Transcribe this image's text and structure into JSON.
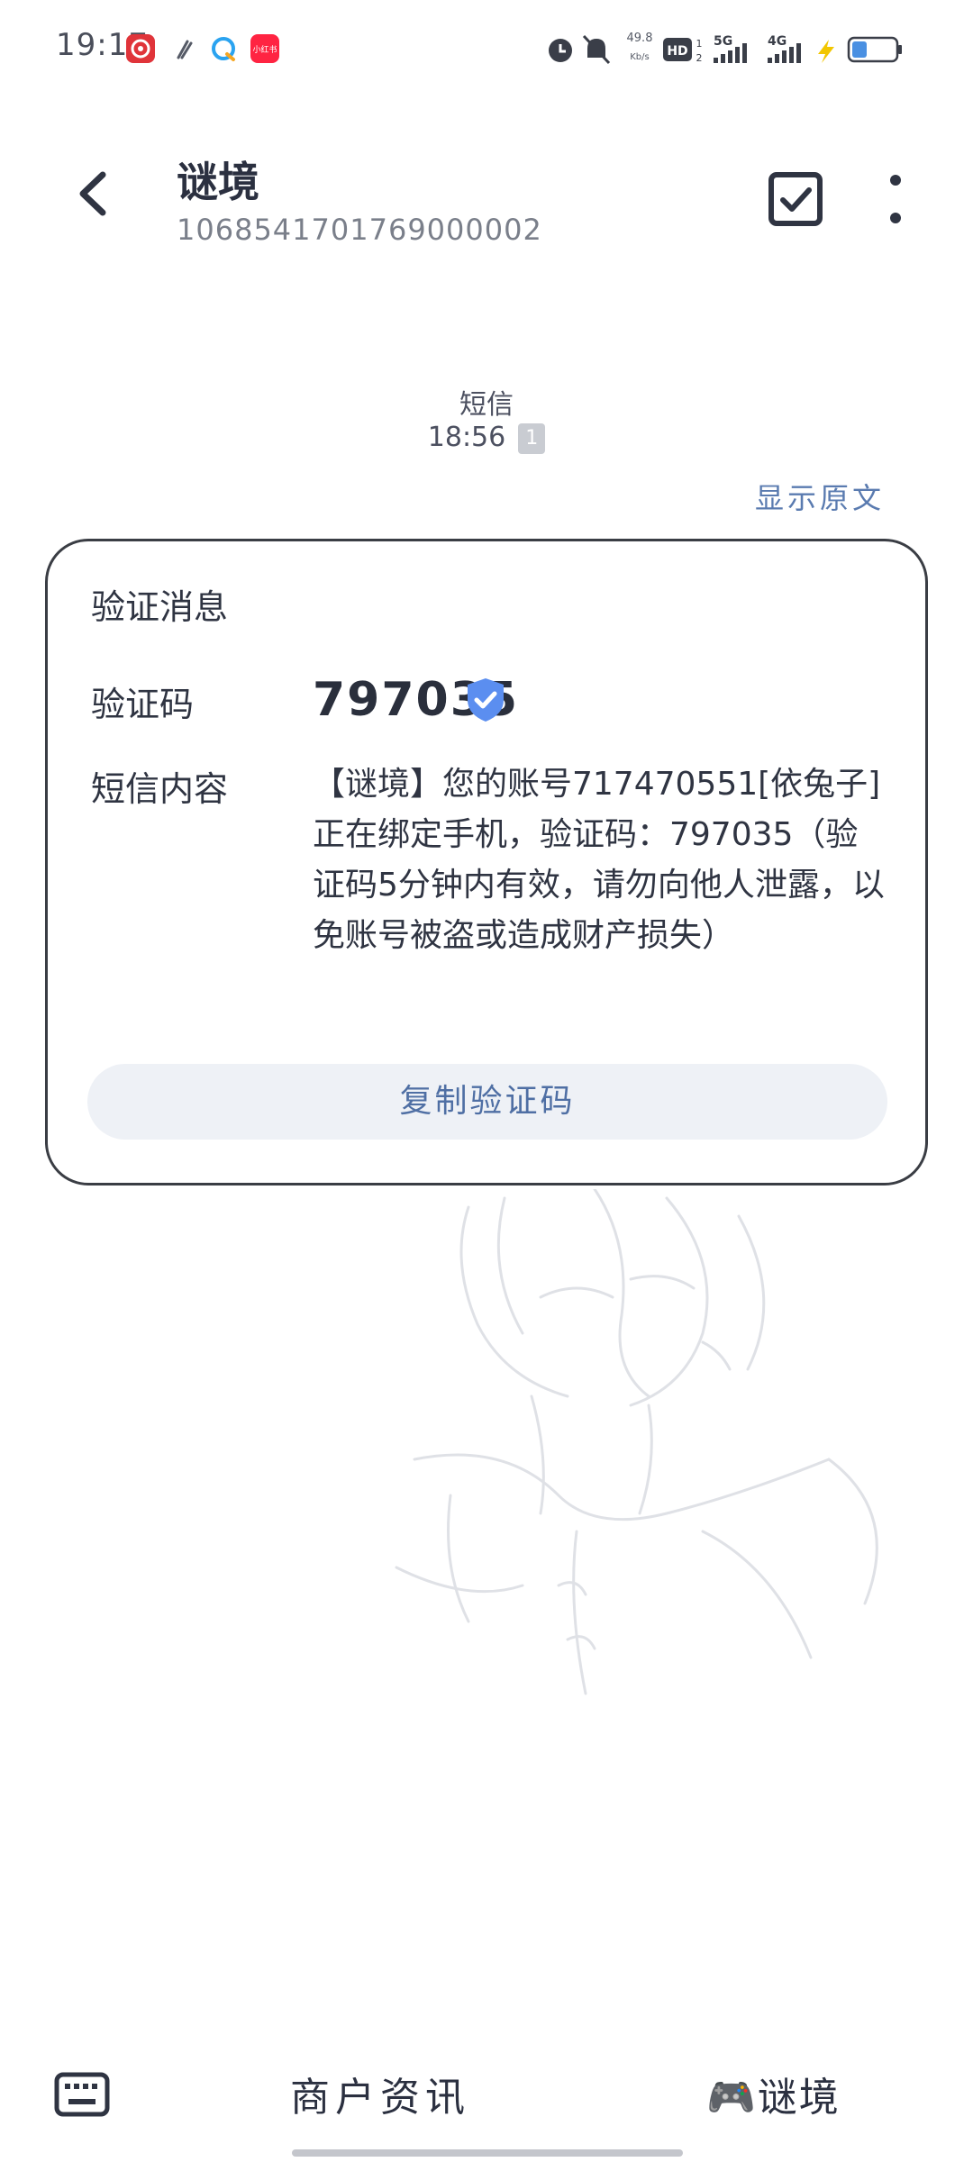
{
  "status_bar": {
    "time": "19:17",
    "net_speed_value": "49.8",
    "net_speed_unit": "Kb/s",
    "hd_label": "HD",
    "hd_sub_top": "1",
    "hd_sub_bottom": "2",
    "network_1": "5G",
    "network_2": "4G",
    "app_icons": [
      "netease-music-icon",
      "feather-icon",
      "qq-browser-icon",
      "xiaohongshu-icon"
    ],
    "xiaohongshu_label": "小红书"
  },
  "header": {
    "contact_name": "谜境",
    "contact_number": "1068541701769000002"
  },
  "message_meta": {
    "type": "短信",
    "time": "18:56",
    "sim_slot": "1",
    "show_original": "显示原文"
  },
  "card": {
    "title": "验证消息",
    "code_label": "验证码",
    "code_value": "797035",
    "content_label": "短信内容",
    "content_text": "【谜境】您的账号717470551[依兔子]正在绑定手机，验证码：797035（验证码5分钟内有效，请勿向他人泄露，以免账号被盗或造成财产损失）",
    "copy_button": "复制验证码"
  },
  "bottom_bar": {
    "menu_1": "商户资讯",
    "menu_2": "🎮谜境"
  },
  "colors": {
    "accent_blue": "#5a7bb0",
    "verified_blue": "#5b8ef0",
    "copy_button_bg": "#eef1f6",
    "card_border": "#3a3d44"
  }
}
